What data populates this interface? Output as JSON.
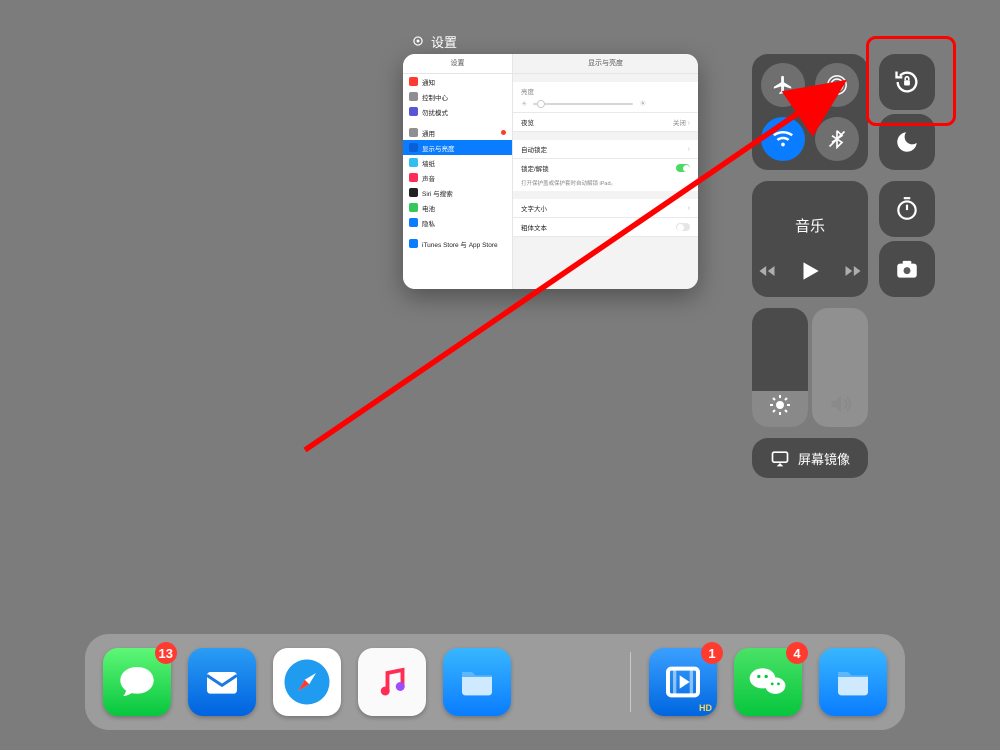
{
  "settings": {
    "window_title": "设置",
    "sidebar_header": "设置",
    "main_header": "显示与亮度",
    "sidebar_items": [
      {
        "label": "通知",
        "color": "#ff3b30"
      },
      {
        "label": "控制中心",
        "color": "#8e8e93"
      },
      {
        "label": "勿扰模式",
        "color": "#5856d6"
      },
      {
        "label": "通用",
        "color": "#8e8e93"
      },
      {
        "label": "显示与亮度",
        "color": "#0a7cff",
        "selected": true
      },
      {
        "label": "墙纸",
        "color": "#34c759"
      },
      {
        "label": "声音",
        "color": "#ff2d55"
      },
      {
        "label": "Siri 与搜索",
        "color": "#222"
      },
      {
        "label": "电池",
        "color": "#34c759"
      },
      {
        "label": "隐私",
        "color": "#0a7cff"
      },
      {
        "label": "iTunes Store 与 App Store",
        "color": "#0a7cff"
      }
    ],
    "rows": {
      "brightness_label": "亮度",
      "nightshift_label": "夜览",
      "nightshift_value": "关闭",
      "autolock_label": "自动锁定",
      "lockunlock_label": "锁定/解锁",
      "lockunlock_sub": "打开保护盖或保护套时自动解锁 iPad。",
      "textsize_label": "文字大小",
      "boldtext_label": "粗体文本"
    }
  },
  "control_center": {
    "media_title": "音乐",
    "mirror_label": "屏幕镜像"
  },
  "dock": {
    "badges": {
      "messages": "13",
      "video": "1",
      "wechat": "4"
    }
  },
  "highlight_color": "#ff0000"
}
